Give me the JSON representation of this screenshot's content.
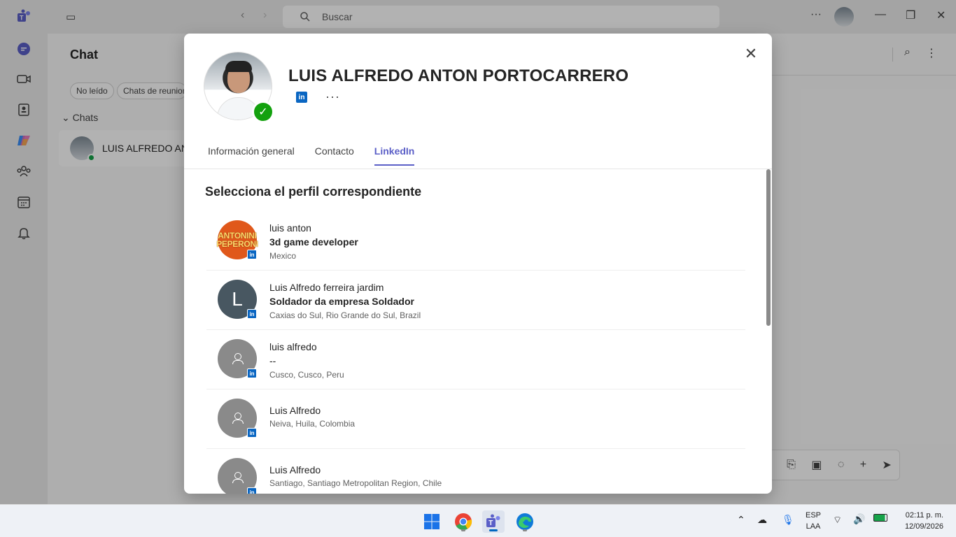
{
  "topbar": {
    "search_placeholder": "Buscar"
  },
  "sidebar": {
    "title": "Chat"
  },
  "filters": [
    "No leído",
    "Chats de reunion"
  ],
  "chats_section": {
    "label": "Chats",
    "item_name": "LUIS ALFREDO ANT"
  },
  "profile": {
    "name": "LUIS ALFREDO ANTON PORTOCARRERO",
    "more_label": "···",
    "linkedin_badge": "in"
  },
  "tabs": [
    {
      "label": "Información general",
      "active": false
    },
    {
      "label": "Contacto",
      "active": false
    },
    {
      "label": "LinkedIn",
      "active": true
    }
  ],
  "section_title": "Selecciona el perfil correspondiente",
  "results": [
    {
      "name": "luis anton",
      "headline": "3d game developer",
      "location": "Mexico",
      "avatar_text_1": "ANTONINI",
      "avatar_text_2": "PEPERONI"
    },
    {
      "name": "Luis Alfredo ferreira jardim",
      "headline": "Soldador da empresa Soldador",
      "location": "Caxias do Sul, Rio Grande do Sul, Brazil",
      "avatar_letter": "L"
    },
    {
      "name": "luis alfredo",
      "headline": "--",
      "location": "Cusco, Cusco, Peru"
    },
    {
      "name": "Luis Alfredo",
      "location": "Neiva, Huila, Colombia"
    },
    {
      "name": "Luis Alfredo",
      "location": "Santiago, Santiago Metropolitan Region, Chile"
    }
  ],
  "taskbar": {
    "lang_1": "ESP",
    "lang_2": "LAA",
    "time": "02:11 p. m.",
    "date": "12/09/2026"
  },
  "colors": {
    "accent": "#5b5fc7",
    "linkedin": "#0a66c2",
    "presence": "#13a10e"
  }
}
